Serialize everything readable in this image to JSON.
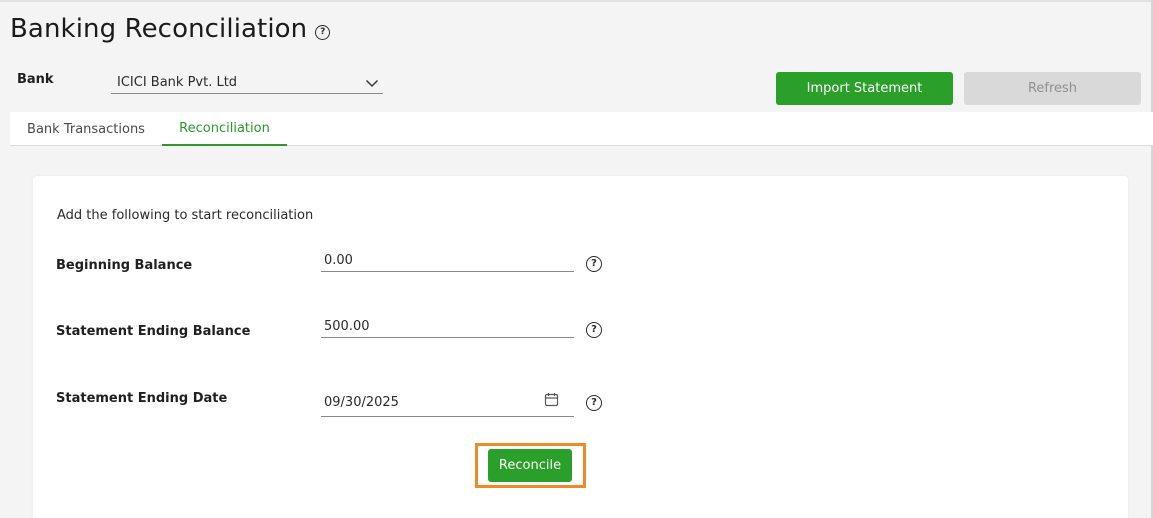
{
  "header": {
    "title": "Banking Reconciliation",
    "help_icon": "question-circle-icon"
  },
  "bank": {
    "label": "Bank",
    "selected": "ICICI Bank Pvt. Ltd",
    "dropdown_icon": "chevron-down-icon"
  },
  "actions": {
    "import_label": "Import Statement",
    "refresh_label": "Refresh",
    "accent_color": "#2aa02a"
  },
  "tabs": [
    {
      "label": "Bank Transactions",
      "active": false
    },
    {
      "label": "Reconciliation",
      "active": true
    }
  ],
  "reconciliation": {
    "intro": "Add the following to start reconciliation",
    "fields": [
      {
        "label": "Beginning Balance",
        "value": "0.00"
      },
      {
        "label": "Statement Ending Balance",
        "value": "500.00"
      },
      {
        "label": "Statement Ending Date",
        "value": "09/30/2025",
        "icon": "calendar-icon"
      }
    ],
    "submit_label": "Reconcile",
    "highlight_color": "#f08a24"
  }
}
